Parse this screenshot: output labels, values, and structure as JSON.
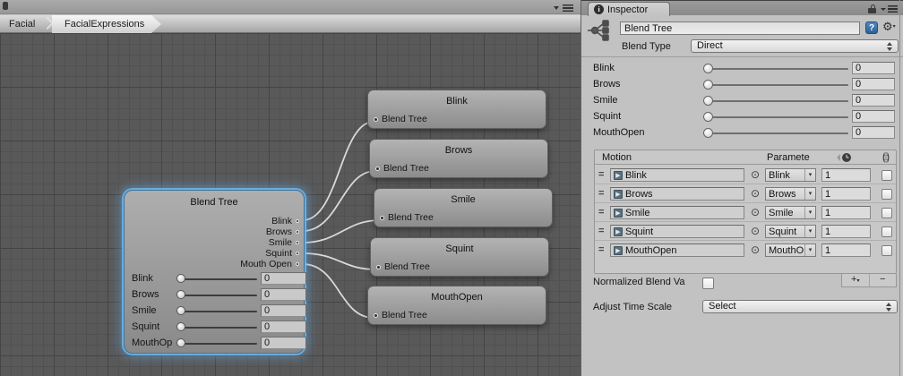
{
  "colors": {
    "selection_blue": "#6eb2e6",
    "panel_bg": "#c2c2c2",
    "graph_bg": "#595959",
    "wire": "#d9d9d9",
    "help_blue": "#3f78b0"
  },
  "graph": {
    "breadcrumbs": [
      {
        "label": "Facial"
      },
      {
        "label": "FacialExpressions"
      }
    ],
    "blend_tree_node": {
      "title": "Blend Tree",
      "outputs": [
        {
          "label": "Blink"
        },
        {
          "label": "Brows"
        },
        {
          "label": "Smile"
        },
        {
          "label": "Squint"
        },
        {
          "label": "Mouth Open"
        }
      ],
      "sliders": [
        {
          "label": "Blink",
          "value": "0"
        },
        {
          "label": "Brows",
          "value": "0"
        },
        {
          "label": "Smile",
          "value": "0"
        },
        {
          "label": "Squint",
          "value": "0"
        },
        {
          "label": "MouthOp",
          "value": "0"
        }
      ]
    },
    "child_nodes": [
      {
        "title": "Blink",
        "input_label": "Blend Tree"
      },
      {
        "title": "Brows",
        "input_label": "Blend Tree"
      },
      {
        "title": "Smile",
        "input_label": "Blend Tree"
      },
      {
        "title": "Squint",
        "input_label": "Blend Tree"
      },
      {
        "title": "MouthOpen",
        "input_label": "Blend Tree"
      }
    ]
  },
  "inspector": {
    "tab_label": "Inspector",
    "name_field": "Blend Tree",
    "blend_type": {
      "label": "Blend Type",
      "value": "Direct"
    },
    "sliders": [
      {
        "label": "Blink",
        "value": "0"
      },
      {
        "label": "Brows",
        "value": "0"
      },
      {
        "label": "Smile",
        "value": "0"
      },
      {
        "label": "Squint",
        "value": "0"
      },
      {
        "label": "MouthOpen",
        "value": "0"
      }
    ],
    "motion_table": {
      "motion_header": "Motion",
      "parameter_header": "Paramete",
      "rows": [
        {
          "motion": "Blink",
          "parameter": "Blink",
          "value": "1"
        },
        {
          "motion": "Brows",
          "parameter": "Brows",
          "value": "1"
        },
        {
          "motion": "Smile",
          "parameter": "Smile",
          "value": "1"
        },
        {
          "motion": "Squint",
          "parameter": "Squint",
          "value": "1"
        },
        {
          "motion": "MouthOpen",
          "parameter": "MouthO",
          "value": "1"
        }
      ],
      "add_label": "+",
      "remove_label": "−"
    },
    "normalized_label": "Normalized Blend Va",
    "adjust_time_scale": {
      "label": "Adjust Time Scale",
      "value": "Select"
    }
  }
}
